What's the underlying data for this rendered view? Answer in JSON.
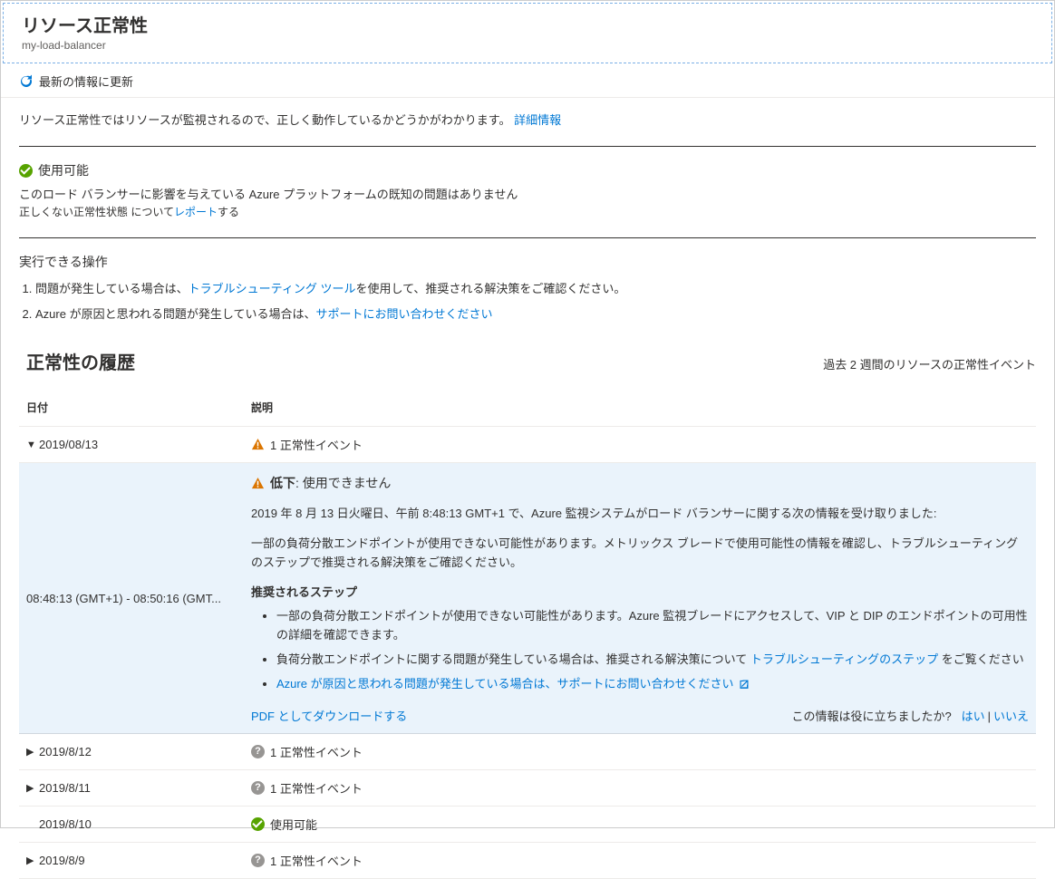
{
  "header": {
    "title": "リソース正常性",
    "subtitle": "my-load-balancer"
  },
  "toolbar": {
    "refresh_label": "最新の情報に更新"
  },
  "description": {
    "text": "リソース正常性ではリソースが監視されるので、正しく動作しているかどうかがわかります。",
    "link_label": "詳細情報"
  },
  "status": {
    "label": "使用可能",
    "detail": "このロード バランサーに影響を与えている Azure プラットフォームの既知の問題はありません",
    "report_prefix": "正しくない正常性状態 について",
    "report_link": "レポート",
    "report_suffix": "する"
  },
  "actions": {
    "title": "実行できる操作",
    "item1_prefix": "問題が発生している場合は、",
    "item1_link": "トラブルシューティング ツール",
    "item1_suffix": "を使用して、推奨される解決策をご確認ください。",
    "item2_prefix": "Azure が原因と思われる問題が発生している場合は、",
    "item2_link": "サポートにお問い合わせください"
  },
  "history": {
    "title": "正常性の履歴",
    "subtitle": "過去 2 週間のリソースの正常性イベント",
    "th_date": "日付",
    "th_desc": "説明"
  },
  "rows": {
    "r0_date": "2019/08/13",
    "r0_desc": "1 正常性イベント",
    "r1_date": "2019/8/12",
    "r1_desc": "1 正常性イベント",
    "r2_date": "2019/8/11",
    "r2_desc": "1 正常性イベント",
    "r3_date": "2019/8/10",
    "r3_desc": "使用可能",
    "r4_date": "2019/8/9",
    "r4_desc": "1 正常性イベント"
  },
  "expanded": {
    "time_range": "08:48:13 (GMT+1) - 08:50:16 (GMT...",
    "title_bold": "低下",
    "title_rest": ": 使用できません",
    "p1": "2019 年 8 月 13 日火曜日、午前 8:48:13 GMT+1 で、Azure 監視システムがロード バランサーに関する次の情報を受け取りました:",
    "p2": "一部の負荷分散エンドポイントが使用できない可能性があります。メトリックス ブレードで使用可能性の情報を確認し、トラブルシューティングのステップで推奨される解決策をご確認ください。",
    "steps_title": "推奨されるステップ",
    "step1": "一部の負荷分散エンドポイントが使用できない可能性があります。Azure 監視ブレードにアクセスして、VIP と DIP のエンドポイントの可用性の詳細を確認できます。",
    "step2_prefix": "負荷分散エンドポイントに関する問題が発生している場合は、推奨される解決策について ",
    "step2_link": "トラブルシューティングのステップ",
    "step2_suffix": " をご覧ください",
    "step3_link": "Azure が原因と思われる問題が発生している場合は、サポートにお問い合わせください",
    "pdf_link": "PDF としてダウンロードする",
    "helpful_prompt": "この情報は役に立ちましたか?",
    "yes": "はい",
    "no": "いいえ"
  }
}
